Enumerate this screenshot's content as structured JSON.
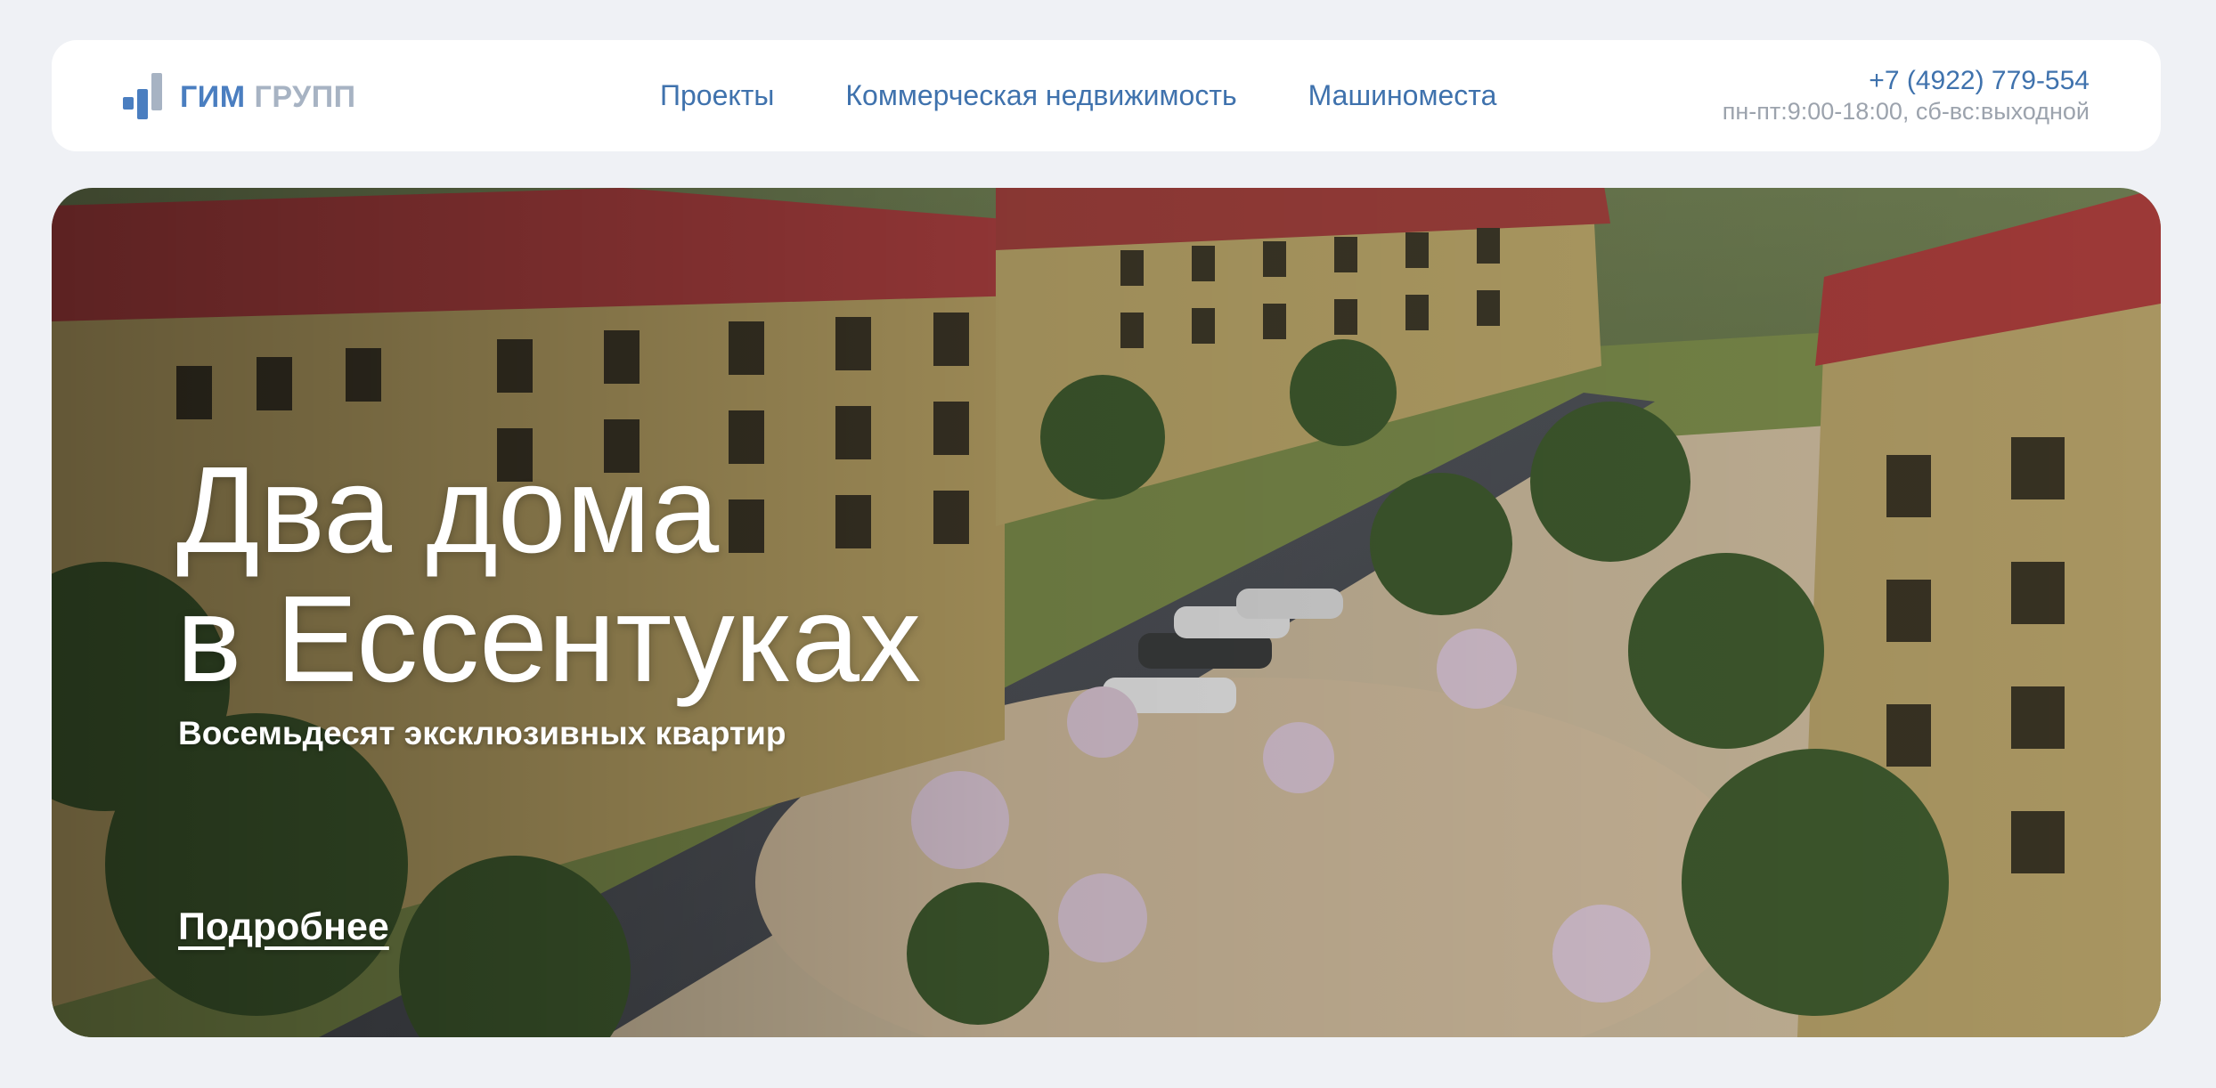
{
  "header": {
    "logo": {
      "part1": "ГИМ",
      "part2": "ГРУПП"
    },
    "nav": [
      {
        "label": "Проекты"
      },
      {
        "label": "Коммерческая недвижимость"
      },
      {
        "label": "Машиноместа"
      }
    ],
    "contact": {
      "phone": "+7 (4922) 779-554",
      "hours": "пн-пт:9:00-18:00, сб-вс:выходной"
    }
  },
  "hero": {
    "title_line1": "Два дома",
    "title_line2": "в Ессентуках",
    "subtitle": "Восемьдесят эксклюзивных квартир",
    "link_label": "Подробнее",
    "image": "residential-complex-aerial-render"
  },
  "colors": {
    "background": "#eff1f5",
    "accent": "#3f72ad",
    "logo_blue": "#4a7ec0",
    "logo_grey": "#a7b3c3",
    "muted_text": "#9ca3ad",
    "roof": "#a33c3c",
    "brick": "#b8a66a"
  }
}
